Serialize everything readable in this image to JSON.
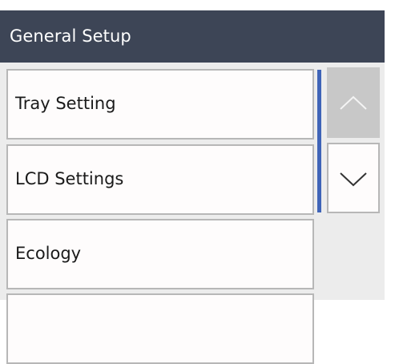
{
  "header": {
    "title": "General Setup"
  },
  "menu": {
    "items": [
      {
        "label": "Tray Setting"
      },
      {
        "label": "LCD Settings"
      },
      {
        "label": "Ecology"
      }
    ]
  },
  "scroll": {
    "up_icon": "chevron-up-icon",
    "down_icon": "chevron-down-icon",
    "up_enabled": false,
    "down_enabled": true
  },
  "colors": {
    "header_bg": "#3d4556",
    "accent": "#3f64b8",
    "item_bg": "#fefcfc",
    "panel_bg": "#ececec",
    "disabled_button_bg": "#c8c8c8"
  }
}
